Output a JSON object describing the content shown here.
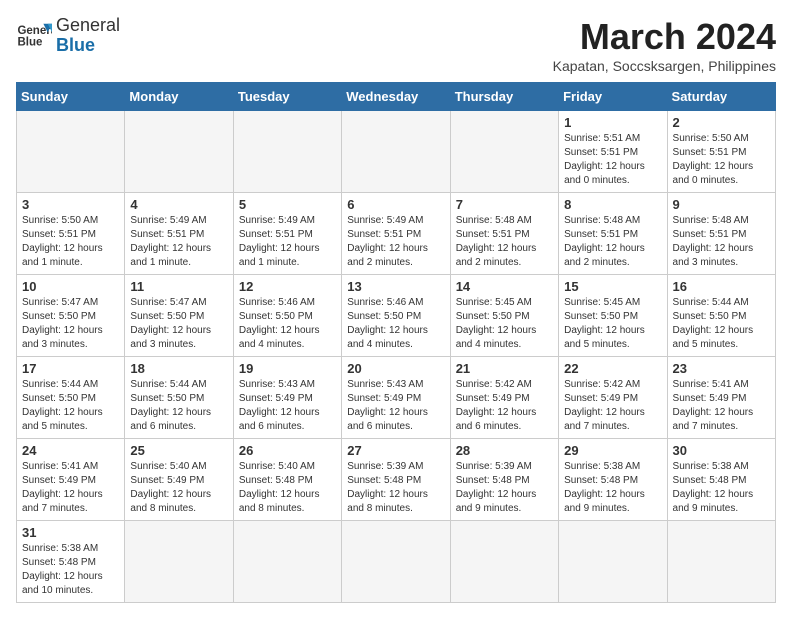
{
  "header": {
    "logo_line1": "General",
    "logo_line2": "Blue",
    "title": "March 2024",
    "subtitle": "Kapatan, Soccsksargen, Philippines"
  },
  "weekdays": [
    "Sunday",
    "Monday",
    "Tuesday",
    "Wednesday",
    "Thursday",
    "Friday",
    "Saturday"
  ],
  "weeks": [
    [
      {
        "day": "",
        "info": ""
      },
      {
        "day": "",
        "info": ""
      },
      {
        "day": "",
        "info": ""
      },
      {
        "day": "",
        "info": ""
      },
      {
        "day": "",
        "info": ""
      },
      {
        "day": "1",
        "info": "Sunrise: 5:51 AM\nSunset: 5:51 PM\nDaylight: 12 hours\nand 0 minutes."
      },
      {
        "day": "2",
        "info": "Sunrise: 5:50 AM\nSunset: 5:51 PM\nDaylight: 12 hours\nand 0 minutes."
      }
    ],
    [
      {
        "day": "3",
        "info": "Sunrise: 5:50 AM\nSunset: 5:51 PM\nDaylight: 12 hours\nand 1 minute."
      },
      {
        "day": "4",
        "info": "Sunrise: 5:49 AM\nSunset: 5:51 PM\nDaylight: 12 hours\nand 1 minute."
      },
      {
        "day": "5",
        "info": "Sunrise: 5:49 AM\nSunset: 5:51 PM\nDaylight: 12 hours\nand 1 minute."
      },
      {
        "day": "6",
        "info": "Sunrise: 5:49 AM\nSunset: 5:51 PM\nDaylight: 12 hours\nand 2 minutes."
      },
      {
        "day": "7",
        "info": "Sunrise: 5:48 AM\nSunset: 5:51 PM\nDaylight: 12 hours\nand 2 minutes."
      },
      {
        "day": "8",
        "info": "Sunrise: 5:48 AM\nSunset: 5:51 PM\nDaylight: 12 hours\nand 2 minutes."
      },
      {
        "day": "9",
        "info": "Sunrise: 5:48 AM\nSunset: 5:51 PM\nDaylight: 12 hours\nand 3 minutes."
      }
    ],
    [
      {
        "day": "10",
        "info": "Sunrise: 5:47 AM\nSunset: 5:50 PM\nDaylight: 12 hours\nand 3 minutes."
      },
      {
        "day": "11",
        "info": "Sunrise: 5:47 AM\nSunset: 5:50 PM\nDaylight: 12 hours\nand 3 minutes."
      },
      {
        "day": "12",
        "info": "Sunrise: 5:46 AM\nSunset: 5:50 PM\nDaylight: 12 hours\nand 4 minutes."
      },
      {
        "day": "13",
        "info": "Sunrise: 5:46 AM\nSunset: 5:50 PM\nDaylight: 12 hours\nand 4 minutes."
      },
      {
        "day": "14",
        "info": "Sunrise: 5:45 AM\nSunset: 5:50 PM\nDaylight: 12 hours\nand 4 minutes."
      },
      {
        "day": "15",
        "info": "Sunrise: 5:45 AM\nSunset: 5:50 PM\nDaylight: 12 hours\nand 5 minutes."
      },
      {
        "day": "16",
        "info": "Sunrise: 5:44 AM\nSunset: 5:50 PM\nDaylight: 12 hours\nand 5 minutes."
      }
    ],
    [
      {
        "day": "17",
        "info": "Sunrise: 5:44 AM\nSunset: 5:50 PM\nDaylight: 12 hours\nand 5 minutes."
      },
      {
        "day": "18",
        "info": "Sunrise: 5:44 AM\nSunset: 5:50 PM\nDaylight: 12 hours\nand 6 minutes."
      },
      {
        "day": "19",
        "info": "Sunrise: 5:43 AM\nSunset: 5:49 PM\nDaylight: 12 hours\nand 6 minutes."
      },
      {
        "day": "20",
        "info": "Sunrise: 5:43 AM\nSunset: 5:49 PM\nDaylight: 12 hours\nand 6 minutes."
      },
      {
        "day": "21",
        "info": "Sunrise: 5:42 AM\nSunset: 5:49 PM\nDaylight: 12 hours\nand 6 minutes."
      },
      {
        "day": "22",
        "info": "Sunrise: 5:42 AM\nSunset: 5:49 PM\nDaylight: 12 hours\nand 7 minutes."
      },
      {
        "day": "23",
        "info": "Sunrise: 5:41 AM\nSunset: 5:49 PM\nDaylight: 12 hours\nand 7 minutes."
      }
    ],
    [
      {
        "day": "24",
        "info": "Sunrise: 5:41 AM\nSunset: 5:49 PM\nDaylight: 12 hours\nand 7 minutes."
      },
      {
        "day": "25",
        "info": "Sunrise: 5:40 AM\nSunset: 5:49 PM\nDaylight: 12 hours\nand 8 minutes."
      },
      {
        "day": "26",
        "info": "Sunrise: 5:40 AM\nSunset: 5:48 PM\nDaylight: 12 hours\nand 8 minutes."
      },
      {
        "day": "27",
        "info": "Sunrise: 5:39 AM\nSunset: 5:48 PM\nDaylight: 12 hours\nand 8 minutes."
      },
      {
        "day": "28",
        "info": "Sunrise: 5:39 AM\nSunset: 5:48 PM\nDaylight: 12 hours\nand 9 minutes."
      },
      {
        "day": "29",
        "info": "Sunrise: 5:38 AM\nSunset: 5:48 PM\nDaylight: 12 hours\nand 9 minutes."
      },
      {
        "day": "30",
        "info": "Sunrise: 5:38 AM\nSunset: 5:48 PM\nDaylight: 12 hours\nand 9 minutes."
      }
    ],
    [
      {
        "day": "31",
        "info": "Sunrise: 5:38 AM\nSunset: 5:48 PM\nDaylight: 12 hours\nand 10 minutes."
      },
      {
        "day": "",
        "info": ""
      },
      {
        "day": "",
        "info": ""
      },
      {
        "day": "",
        "info": ""
      },
      {
        "day": "",
        "info": ""
      },
      {
        "day": "",
        "info": ""
      },
      {
        "day": "",
        "info": ""
      }
    ]
  ]
}
